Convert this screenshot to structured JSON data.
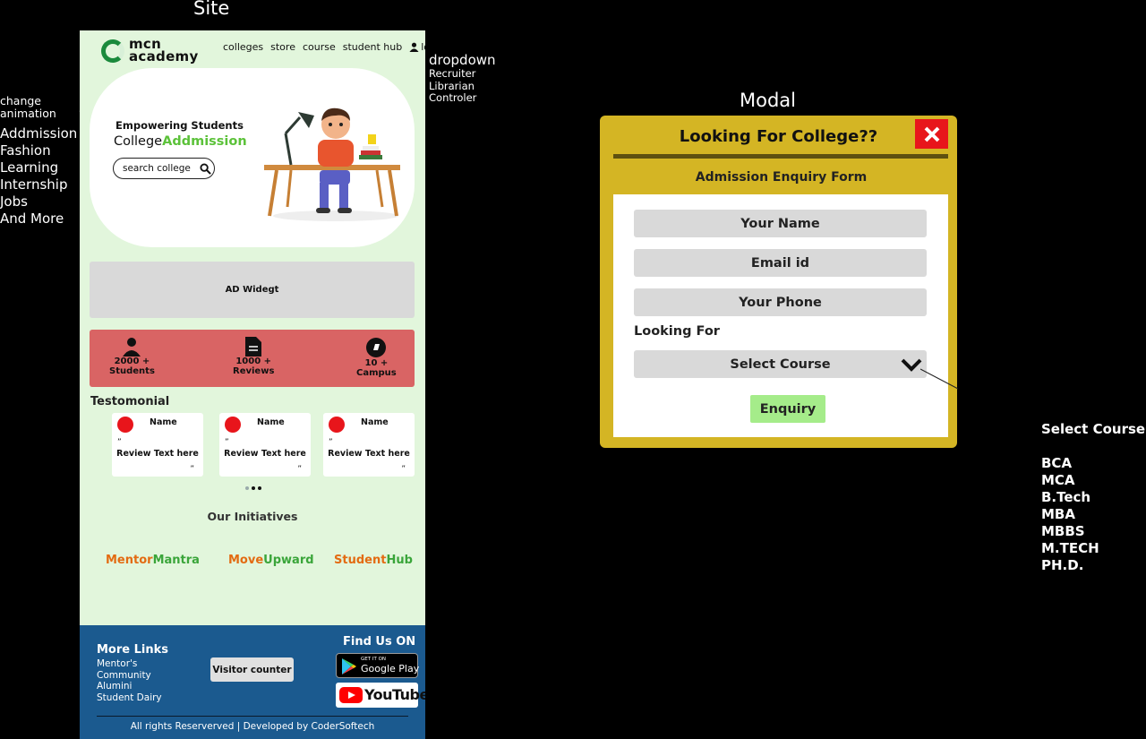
{
  "annotations": {
    "site_title": "Site",
    "modal_title": "Modal",
    "change_animation": [
      "change",
      "animation"
    ],
    "animation_words": [
      "Addmission",
      "Fashion",
      "Learning",
      "Internship",
      "Jobs",
      "And More"
    ],
    "dropdown_title": "dropdown",
    "dropdown_items": [
      "Recruiter",
      "Librarian",
      "Controler"
    ]
  },
  "site": {
    "logo_text": [
      "mcn",
      "academy"
    ],
    "nav": [
      "colleges",
      "store",
      "course",
      "student hub"
    ],
    "login_label": "login",
    "hero": {
      "tagline": "Empowering Students",
      "prefix": "College",
      "highlight": "Addmission",
      "search_placeholder": "search college"
    },
    "ad_label": "AD Widegt",
    "stats": [
      {
        "icon": "person-icon",
        "value": "2000 +",
        "label": "Students"
      },
      {
        "icon": "document-icon",
        "value": "1000 +",
        "label": "Reviews"
      },
      {
        "icon": "campus-icon",
        "value": "10 +",
        "label": "Campus"
      }
    ],
    "testimonials_heading": "Testomonial",
    "testimonials": [
      {
        "name": "Name",
        "open_quote": "”",
        "review": "Review Text here",
        "close_quote": "”"
      },
      {
        "name": "Name",
        "open_quote": "”",
        "review": "Review Text here",
        "close_quote": "”"
      },
      {
        "name": "Name",
        "open_quote": "”",
        "review": "Review Text here",
        "close_quote": "”"
      }
    ],
    "initiatives_heading": "Our Initiatives",
    "initiatives": [
      {
        "a": "Mentor",
        "b": "Mantra"
      },
      {
        "a": "Move",
        "b": "Upward"
      },
      {
        "a": "Student",
        "b": "Hub"
      }
    ],
    "footer": {
      "more_links_heading": "More Links",
      "links": [
        "Mentor's",
        "Community",
        "Alumini",
        "Student Dairy"
      ],
      "visitor_counter": "Visitor counter",
      "find_us": "Find Us ON",
      "google_play_small": "GET IT ON",
      "google_play": "Google Play",
      "youtube": "YouTube",
      "copyright": "All rights Reserverved | Developed by CoderSoftech"
    }
  },
  "modal": {
    "title": "Looking For College??",
    "subtitle": "Admission Enquiry Form",
    "name_placeholder": "Your Name",
    "email_placeholder": "Email id",
    "phone_placeholder": "Your Phone",
    "looking_for_label": "Looking For",
    "select_placeholder": "Select Course",
    "submit_label": "Enquiry"
  },
  "course_options": {
    "heading": "Select Courses",
    "items": [
      "BCA",
      "MCA",
      "B.Tech",
      "MBA",
      "MBBS",
      "M.TECH",
      "PH.D."
    ]
  },
  "colors": {
    "site_bg": "#e2f6dc",
    "accent_green": "#5cc23a",
    "stats_red": "#d96464",
    "footer_blue": "#1b5a8f",
    "modal_yellow": "#d4b524",
    "close_red": "#e8161b",
    "enquiry_green": "#a5ec8a",
    "initiative_orange": "#e36b12"
  }
}
